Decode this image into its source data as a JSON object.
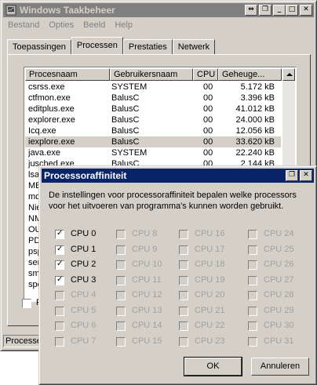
{
  "main_window": {
    "title": "Windows Taakbeheer",
    "menu": [
      "Bestand",
      "Opties",
      "Beeld",
      "Help"
    ],
    "tabs": [
      "Toepassingen",
      "Processen",
      "Prestaties",
      "Netwerk"
    ],
    "active_tab": "Processen",
    "columns": [
      "Procesnaam",
      "Gebruikersnaam",
      "CPU",
      "Geheuge..."
    ],
    "rows": [
      {
        "name": "csrss.exe",
        "user": "SYSTEM",
        "cpu": "00",
        "mem": "5.172 kB"
      },
      {
        "name": "ctfmon.exe",
        "user": "BalusC",
        "cpu": "00",
        "mem": "3.396 kB"
      },
      {
        "name": "editplus.exe",
        "user": "BalusC",
        "cpu": "00",
        "mem": "41.012 kB"
      },
      {
        "name": "explorer.exe",
        "user": "BalusC",
        "cpu": "00",
        "mem": "24.000 kB"
      },
      {
        "name": "Icq.exe",
        "user": "BalusC",
        "cpu": "00",
        "mem": "12.056 kB"
      },
      {
        "name": "iexplore.exe",
        "user": "BalusC",
        "cpu": "00",
        "mem": "33.620 kB"
      },
      {
        "name": "java.exe",
        "user": "SYSTEM",
        "cpu": "00",
        "mem": "22.240 kB"
      },
      {
        "name": "jusched.exe",
        "user": "BalusC",
        "cpu": "00",
        "mem": "2.144 kB"
      },
      {
        "name": "lsas",
        "user": "",
        "cpu": "",
        "mem": ""
      },
      {
        "name": "MBI",
        "user": "",
        "cpu": "",
        "mem": ""
      },
      {
        "name": "mdr",
        "user": "",
        "cpu": "",
        "mem": ""
      },
      {
        "name": "Nie",
        "user": "",
        "cpu": "",
        "mem": ""
      },
      {
        "name": "NM",
        "user": "",
        "cpu": "",
        "mem": ""
      },
      {
        "name": "OU",
        "user": "",
        "cpu": "",
        "mem": ""
      },
      {
        "name": "PDe",
        "user": "",
        "cpu": "",
        "mem": ""
      },
      {
        "name": "psp",
        "user": "",
        "cpu": "",
        "mem": ""
      },
      {
        "name": "ser",
        "user": "",
        "cpu": "",
        "mem": ""
      },
      {
        "name": "sms",
        "user": "",
        "cpu": "",
        "mem": ""
      },
      {
        "name": "spo",
        "user": "",
        "cpu": "",
        "mem": ""
      }
    ],
    "selected_row": 5,
    "checkbox_label": "P",
    "status_text": "Processen"
  },
  "dialog": {
    "title": "Processoraffiniteit",
    "description": "De instellingen voor processoraffiniteit bepalen welke processors voor het uitvoeren van programma's kunnen worden gebruikt.",
    "cpus": [
      {
        "label": "CPU 0",
        "checked": true,
        "enabled": true
      },
      {
        "label": "CPU 1",
        "checked": true,
        "enabled": true
      },
      {
        "label": "CPU 2",
        "checked": true,
        "enabled": true
      },
      {
        "label": "CPU 3",
        "checked": true,
        "enabled": true
      },
      {
        "label": "CPU 4",
        "checked": false,
        "enabled": false
      },
      {
        "label": "CPU 5",
        "checked": false,
        "enabled": false
      },
      {
        "label": "CPU 6",
        "checked": false,
        "enabled": false
      },
      {
        "label": "CPU 7",
        "checked": false,
        "enabled": false
      },
      {
        "label": "CPU 8",
        "checked": false,
        "enabled": false
      },
      {
        "label": "CPU 9",
        "checked": false,
        "enabled": false
      },
      {
        "label": "CPU 10",
        "checked": false,
        "enabled": false
      },
      {
        "label": "CPU 11",
        "checked": false,
        "enabled": false
      },
      {
        "label": "CPU 12",
        "checked": false,
        "enabled": false
      },
      {
        "label": "CPU 13",
        "checked": false,
        "enabled": false
      },
      {
        "label": "CPU 14",
        "checked": false,
        "enabled": false
      },
      {
        "label": "CPU 15",
        "checked": false,
        "enabled": false
      },
      {
        "label": "CPU 16",
        "checked": false,
        "enabled": false
      },
      {
        "label": "CPU 17",
        "checked": false,
        "enabled": false
      },
      {
        "label": "CPU 18",
        "checked": false,
        "enabled": false
      },
      {
        "label": "CPU 19",
        "checked": false,
        "enabled": false
      },
      {
        "label": "CPU 20",
        "checked": false,
        "enabled": false
      },
      {
        "label": "CPU 21",
        "checked": false,
        "enabled": false
      },
      {
        "label": "CPU 22",
        "checked": false,
        "enabled": false
      },
      {
        "label": "CPU 23",
        "checked": false,
        "enabled": false
      },
      {
        "label": "CPU 24",
        "checked": false,
        "enabled": false
      },
      {
        "label": "CPU 25",
        "checked": false,
        "enabled": false
      },
      {
        "label": "CPU 26",
        "checked": false,
        "enabled": false
      },
      {
        "label": "CPU 27",
        "checked": false,
        "enabled": false
      },
      {
        "label": "CPU 28",
        "checked": false,
        "enabled": false
      },
      {
        "label": "CPU 29",
        "checked": false,
        "enabled": false
      },
      {
        "label": "CPU 30",
        "checked": false,
        "enabled": false
      },
      {
        "label": "CPU 31",
        "checked": false,
        "enabled": false
      }
    ],
    "ok_label": "OK",
    "cancel_label": "Annuleren"
  },
  "icons": {
    "app_icon": "task-manager-icon",
    "restore": "restore-icon",
    "minimize": "minimize-icon",
    "maximize": "maximize-icon",
    "close": "close-icon",
    "help": "help-icon"
  }
}
